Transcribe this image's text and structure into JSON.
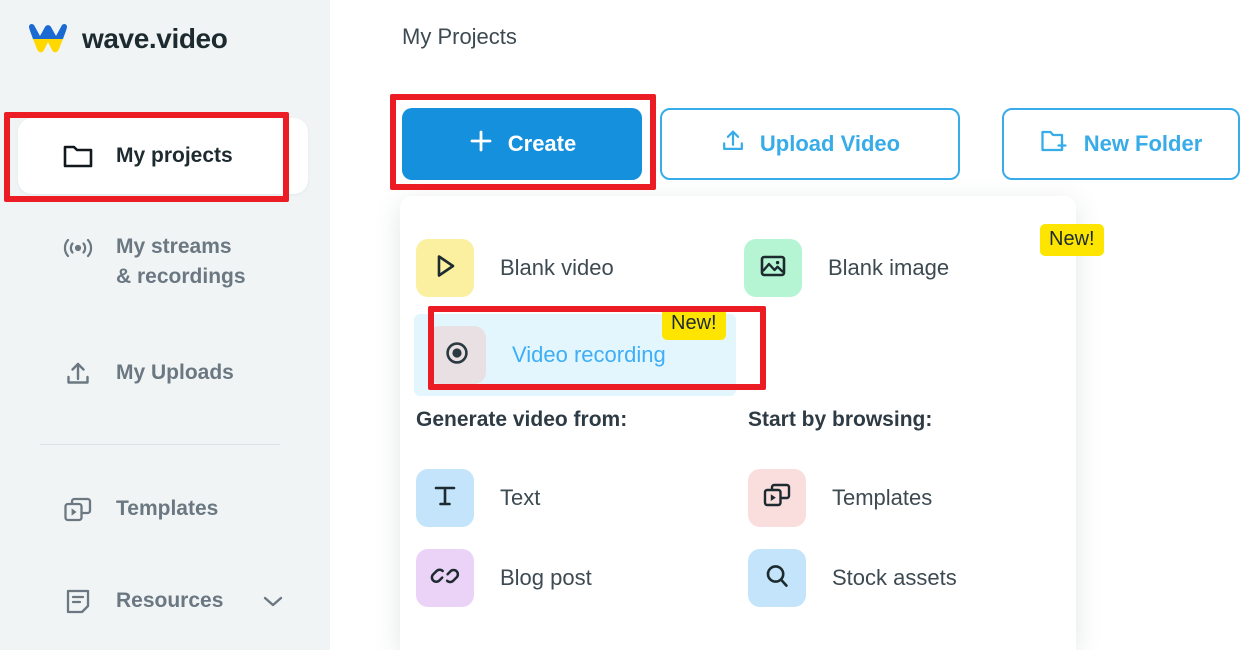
{
  "brand": {
    "name": "wave.video",
    "logo_icon": "wave-logo-icon",
    "logo_colors": {
      "top": "#1b6ad4",
      "bottom": "#ffd800"
    }
  },
  "sidebar": {
    "background": "#f0f4f5",
    "items": [
      {
        "label": "My projects",
        "icon": "folder-icon",
        "active": true
      },
      {
        "label": "My streams\n& recordings",
        "icon": "broadcast-icon",
        "active": false
      },
      {
        "label": "My Uploads",
        "icon": "upload-icon",
        "active": false
      },
      {
        "label": "Templates",
        "icon": "templates-icon",
        "active": false
      },
      {
        "label": "Resources",
        "icon": "document-icon",
        "active": false,
        "chevron": "chevron-down-icon"
      }
    ]
  },
  "main": {
    "page_title": "My Projects",
    "toolbar": {
      "create_label": "Create",
      "create_icon": "plus-icon",
      "create_color": "#1490dc",
      "upload_label": "Upload Video",
      "upload_icon": "upload-icon",
      "folder_label": "New Folder",
      "folder_icon": "folder-plus-icon",
      "outline_color": "#38ace8"
    },
    "dropdown": {
      "primary": [
        {
          "label": "Blank video",
          "icon": "play-icon",
          "tile_color": "#fbefa0",
          "badge": null,
          "highlighted": false
        },
        {
          "label": "Blank image",
          "icon": "image-icon",
          "tile_color": "#b6f5d3",
          "badge": "New!",
          "highlighted": false
        },
        {
          "label": "Video recording",
          "icon": "record-icon",
          "tile_color": "#e9e0e3",
          "badge": "New!",
          "highlighted": true
        }
      ],
      "columns": [
        {
          "heading": "Generate video from:",
          "items": [
            {
              "label": "Text",
              "icon": "text-t-icon",
              "tile_color": "#c3e4fa"
            },
            {
              "label": "Blog post",
              "icon": "link-icon",
              "tile_color": "#ebd3f8"
            }
          ]
        },
        {
          "heading": "Start by browsing:",
          "items": [
            {
              "label": "Templates",
              "icon": "templates-icon",
              "tile_color": "#fadddd"
            },
            {
              "label": "Stock assets",
              "icon": "search-icon",
              "tile_color": "#c3e4fa"
            }
          ]
        }
      ],
      "badge_color": "#fde500",
      "highlight_color": "#e3f6fd",
      "highlight_text_color": "#3daef7"
    }
  },
  "annotations": {
    "color": "#ec1c24",
    "boxes": [
      {
        "name": "my-projects-highlight"
      },
      {
        "name": "create-button-highlight"
      },
      {
        "name": "video-recording-highlight"
      }
    ]
  }
}
